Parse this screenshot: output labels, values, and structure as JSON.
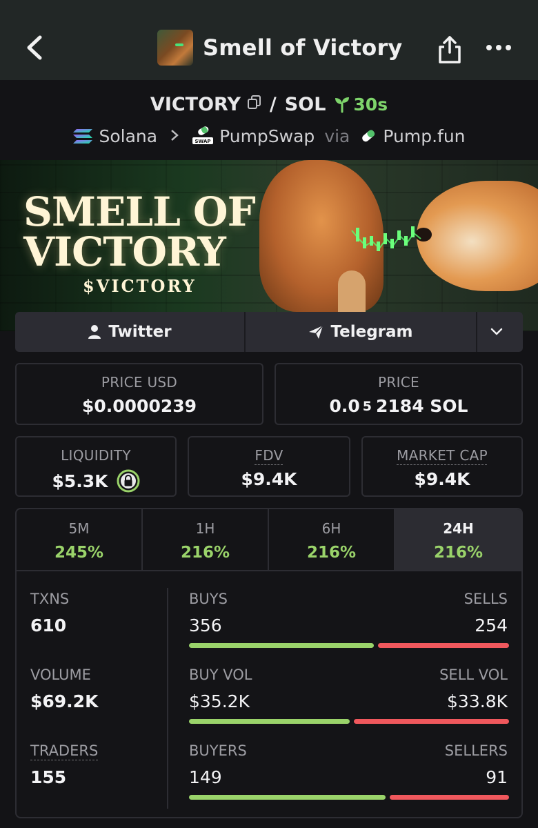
{
  "header": {
    "title": "Smell of Victory",
    "back_icon": "chevron-left-icon",
    "share_icon": "share-icon",
    "more_icon": "more-horizontal-icon"
  },
  "pair": {
    "base": "VICTORY",
    "slash": "/",
    "quote": "SOL",
    "age": "30s"
  },
  "chain": {
    "network": "Solana",
    "dex": "PumpSwap",
    "via": "via",
    "launchpad": "Pump.fun"
  },
  "banner": {
    "line1": "SMELL OF",
    "line2": "VICTORY",
    "ticker": "$VICTORY"
  },
  "social": {
    "twitter": "Twitter",
    "telegram": "Telegram"
  },
  "prices": {
    "usd_label": "PRICE USD",
    "usd_value": "$0.0000239",
    "sol_label": "PRICE",
    "sol_prefix": "0.0",
    "sol_subscript": "5",
    "sol_digits": "2184 SOL"
  },
  "metrics": {
    "liquidity_label": "LIQUIDITY",
    "liquidity_value": "$5.3K",
    "fdv_label": "FDV",
    "fdv_value": "$9.4K",
    "mcap_label": "MARKET CAP",
    "mcap_value": "$9.4K"
  },
  "timeframes": [
    {
      "label": "5M",
      "change": "245%"
    },
    {
      "label": "1H",
      "change": "216%"
    },
    {
      "label": "6H",
      "change": "216%"
    },
    {
      "label": "24H",
      "change": "216%"
    }
  ],
  "selected_timeframe": "24H",
  "stats": {
    "txns": {
      "label": "TXNS",
      "value": "610",
      "buy_label": "BUYS",
      "buy_value": "356",
      "sell_label": "SELLS",
      "sell_value": "254",
      "buy_share": 0.584
    },
    "volume": {
      "label": "VOLUME",
      "value": "$69.2K",
      "buy_label": "BUY VOL",
      "buy_value": "$35.2K",
      "sell_label": "SELL VOL",
      "sell_value": "$33.8K",
      "buy_share": 0.509
    },
    "traders": {
      "label": "TRADERS",
      "value": "155",
      "buy_label": "BUYERS",
      "buy_value": "149",
      "sell_label": "SELLERS",
      "sell_value": "91",
      "buy_share": 0.621
    }
  },
  "colors": {
    "positive": "#9ad36a",
    "negative": "#f0585d",
    "panel": "#141417",
    "header": "#222726"
  }
}
